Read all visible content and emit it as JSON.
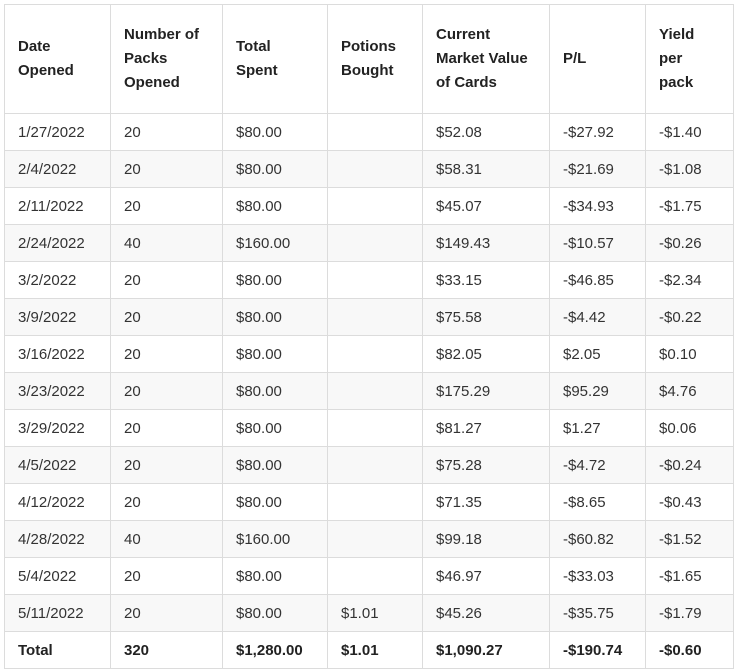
{
  "table": {
    "headers": [
      "Date Opened",
      "Number of Packs Opened",
      "Total Spent",
      "Potions Bought",
      "Current Market Value of Cards",
      "P/L",
      "Yield per pack"
    ],
    "rows": [
      [
        "1/27/2022",
        "20",
        "$80.00",
        "",
        "$52.08",
        "-$27.92",
        "-$1.40"
      ],
      [
        "2/4/2022",
        "20",
        "$80.00",
        "",
        "$58.31",
        "-$21.69",
        "-$1.08"
      ],
      [
        "2/11/2022",
        "20",
        "$80.00",
        "",
        "$45.07",
        "-$34.93",
        "-$1.75"
      ],
      [
        "2/24/2022",
        "40",
        "$160.00",
        "",
        "$149.43",
        "-$10.57",
        "-$0.26"
      ],
      [
        "3/2/2022",
        "20",
        "$80.00",
        "",
        "$33.15",
        "-$46.85",
        "-$2.34"
      ],
      [
        "3/9/2022",
        "20",
        "$80.00",
        "",
        "$75.58",
        "-$4.42",
        "-$0.22"
      ],
      [
        "3/16/2022",
        "20",
        "$80.00",
        "",
        "$82.05",
        "$2.05",
        "$0.10"
      ],
      [
        "3/23/2022",
        "20",
        "$80.00",
        "",
        "$175.29",
        "$95.29",
        "$4.76"
      ],
      [
        "3/29/2022",
        "20",
        "$80.00",
        "",
        "$81.27",
        "$1.27",
        "$0.06"
      ],
      [
        "4/5/2022",
        "20",
        "$80.00",
        "",
        "$75.28",
        "-$4.72",
        "-$0.24"
      ],
      [
        "4/12/2022",
        "20",
        "$80.00",
        "",
        "$71.35",
        "-$8.65",
        "-$0.43"
      ],
      [
        "4/28/2022",
        "40",
        "$160.00",
        "",
        "$99.18",
        "-$60.82",
        "-$1.52"
      ],
      [
        "5/4/2022",
        "20",
        "$80.00",
        "",
        "$46.97",
        "-$33.03",
        "-$1.65"
      ],
      [
        "5/11/2022",
        "20",
        "$80.00",
        "$1.01",
        "$45.26",
        "-$35.75",
        "-$1.79"
      ]
    ],
    "total": [
      "Total",
      "320",
      "$1,280.00",
      "$1.01",
      "$1,090.27",
      "-$190.74",
      "-$0.60"
    ]
  }
}
